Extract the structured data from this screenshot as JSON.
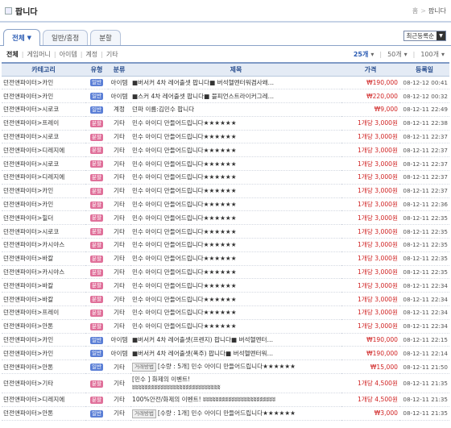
{
  "page": {
    "title": "팝니다",
    "breadcrumb": [
      "홈",
      "팝니다"
    ]
  },
  "tabs": [
    {
      "label": "전체",
      "active": true,
      "has_caret": true
    },
    {
      "label": "일반/흥정",
      "active": false
    },
    {
      "label": "분할",
      "active": false
    }
  ],
  "sort_select": {
    "value": "최근등록순"
  },
  "filters": [
    "전체",
    "게임머니",
    "아이템",
    "계정",
    "기타"
  ],
  "pager": {
    "options": [
      "25개",
      "50개",
      "100개"
    ],
    "selected": "25개"
  },
  "columns": [
    "카테고리",
    "유형",
    "분류",
    "제목",
    "가격",
    "등록일"
  ],
  "rows": [
    {
      "category": "던전앤파이터>카인",
      "type": "일반",
      "kind": "아이템",
      "title": "■버서커 4차 레어출셋 팝니다■ 버석헬멘터워겸사왜…",
      "price_unit": "",
      "price": "₩190,000",
      "date": "08-12-12 00:41"
    },
    {
      "category": "던전앤파이터>카인",
      "type": "일반",
      "kind": "아이템",
      "title": "■스커 4차 레어출셋 팝니다■ 블피언스트라이커그레…",
      "price_unit": "",
      "price": "₩220,000",
      "date": "08-12-12 00:32"
    },
    {
      "category": "던전앤파이터>시로코",
      "type": "일반",
      "kind": "계정",
      "title": "던파 이름:김민수 팝니다",
      "price_unit": "",
      "price": "₩9,000",
      "date": "08-12-11 22:49"
    },
    {
      "category": "던전앤파이터>프레이",
      "type": "분할",
      "kind": "기타",
      "title": "민수 아이디 만들어드립니다★★★★★★",
      "price_unit": "1개당",
      "price": "3,000원",
      "date": "08-12-11 22:38"
    },
    {
      "category": "던전앤파이터>시로코",
      "type": "분할",
      "kind": "기타",
      "title": "민수 아이디 만들어드립니다★★★★★★",
      "price_unit": "1개당",
      "price": "3,000원",
      "date": "08-12-11 22:37"
    },
    {
      "category": "던전앤파이터>디레지에",
      "type": "분할",
      "kind": "기타",
      "title": "민수 아이디 만들어드립니다★★★★★★",
      "price_unit": "1개당",
      "price": "3,000원",
      "date": "08-12-11 22:37"
    },
    {
      "category": "던전앤파이터>시로코",
      "type": "분할",
      "kind": "기타",
      "title": "민수 아이디 만들어드립니다★★★★★★",
      "price_unit": "1개당",
      "price": "3,000원",
      "date": "08-12-11 22:37"
    },
    {
      "category": "던전앤파이터>디레지에",
      "type": "분할",
      "kind": "기타",
      "title": "민수 아이디 만들어드립니다★★★★★★",
      "price_unit": "1개당",
      "price": "3,000원",
      "date": "08-12-11 22:37"
    },
    {
      "category": "던전앤파이터>카인",
      "type": "분할",
      "kind": "기타",
      "title": "민수 아이디 만들어드립니다★★★★★★",
      "price_unit": "1개당",
      "price": "3,000원",
      "date": "08-12-11 22:37"
    },
    {
      "category": "던전앤파이터>카인",
      "type": "분할",
      "kind": "기타",
      "title": "민수 아이디 만들어드립니다★★★★★★",
      "price_unit": "1개당",
      "price": "3,000원",
      "date": "08-12-11 22:36"
    },
    {
      "category": "던전앤파이터>힐더",
      "type": "분할",
      "kind": "기타",
      "title": "민수 아이디 만들어드립니다★★★★★★",
      "price_unit": "1개당",
      "price": "3,000원",
      "date": "08-12-11 22:35"
    },
    {
      "category": "던전앤파이터>시로코",
      "type": "분할",
      "kind": "기타",
      "title": "민수 아이디 만들어드립니다★★★★★★",
      "price_unit": "1개당",
      "price": "3,000원",
      "date": "08-12-11 22:35"
    },
    {
      "category": "던전앤파이터>카시야스",
      "type": "분할",
      "kind": "기타",
      "title": "민수 아이디 만들어드립니다★★★★★★",
      "price_unit": "1개당",
      "price": "3,000원",
      "date": "08-12-11 22:35"
    },
    {
      "category": "던전앤파이터>바칼",
      "type": "분할",
      "kind": "기타",
      "title": "민수 아이디 만들어드립니다★★★★★★",
      "price_unit": "1개당",
      "price": "3,000원",
      "date": "08-12-11 22:35"
    },
    {
      "category": "던전앤파이터>카시야스",
      "type": "분할",
      "kind": "기타",
      "title": "민수 아이디 만들어드립니다★★★★★★",
      "price_unit": "1개당",
      "price": "3,000원",
      "date": "08-12-11 22:35"
    },
    {
      "category": "던전앤파이터>바칼",
      "type": "분할",
      "kind": "기타",
      "title": "민수 아이디 만들어드립니다★★★★★★",
      "price_unit": "1개당",
      "price": "3,000원",
      "date": "08-12-11 22:34"
    },
    {
      "category": "던전앤파이터>바칼",
      "type": "분할",
      "kind": "기타",
      "title": "민수 아이디 만들어드립니다★★★★★★",
      "price_unit": "1개당",
      "price": "3,000원",
      "date": "08-12-11 22:34"
    },
    {
      "category": "던전앤파이터>프레이",
      "type": "분할",
      "kind": "기타",
      "title": "민수 아이디 만들어드립니다★★★★★★",
      "price_unit": "1개당",
      "price": "3,000원",
      "date": "08-12-11 22:34"
    },
    {
      "category": "던전앤파이터>안톤",
      "type": "분할",
      "kind": "기타",
      "title": "민수 아이디 만들어드립니다★★★★★★",
      "price_unit": "1개당",
      "price": "3,000원",
      "date": "08-12-11 22:34"
    },
    {
      "category": "던전앤파이터>카인",
      "type": "일반",
      "kind": "아이템",
      "title": "■버서커 4차 레어출셋(프렌지) 팝니다■ 버석헬멘터…",
      "price_unit": "",
      "price": "₩190,000",
      "date": "08-12-11 22:15"
    },
    {
      "category": "던전앤파이터>카인",
      "type": "일반",
      "kind": "아이템",
      "title": "■버서커 4차 레어출셋(폭주) 팝니다■ 버석헬멘터워…",
      "price_unit": "",
      "price": "₩190,000",
      "date": "08-12-11 22:14"
    },
    {
      "category": "던전앤파이터>안톤",
      "type": "일반",
      "kind": "기타",
      "tag": "거래방법",
      "title": "[수량 : 5개] 민수 아이디 만들어드립니다★★★★★★",
      "price_unit": "",
      "price": "₩15,000",
      "date": "08-12-11 21:50"
    },
    {
      "category": "던전앤파이터>기타",
      "type": "분할",
      "kind": "기타",
      "tall": true,
      "title": "[민수 ] 화제의 이벤트!",
      "title2": "ʬʬʬʬʬʬʬʬʬʬʬʬʬʬʬʬʬʬʬʬʬʬʬʬʬʬʬʬ",
      "price_unit": "1개당",
      "price": "4,500원",
      "date": "08-12-11 21:35"
    },
    {
      "category": "던전앤파이터>디레지에",
      "type": "분할",
      "kind": "기타",
      "title": "100%안전/화제의 이벤트! ʬʬʬʬʬʬʬʬʬʬʬʬʬʬʬʬʬʬʬʬʬʬʬ",
      "price_unit": "1개당",
      "price": "4,500원",
      "date": "08-12-11 21:35"
    },
    {
      "category": "던전앤파이터>안톤",
      "type": "일반",
      "kind": "기타",
      "tag": "거래방법",
      "title": "[수량 : 1개] 민수 아이디 만들어드립니다★★★★★★",
      "price_unit": "",
      "price": "₩3,000",
      "date": "08-12-11 21:35"
    }
  ]
}
